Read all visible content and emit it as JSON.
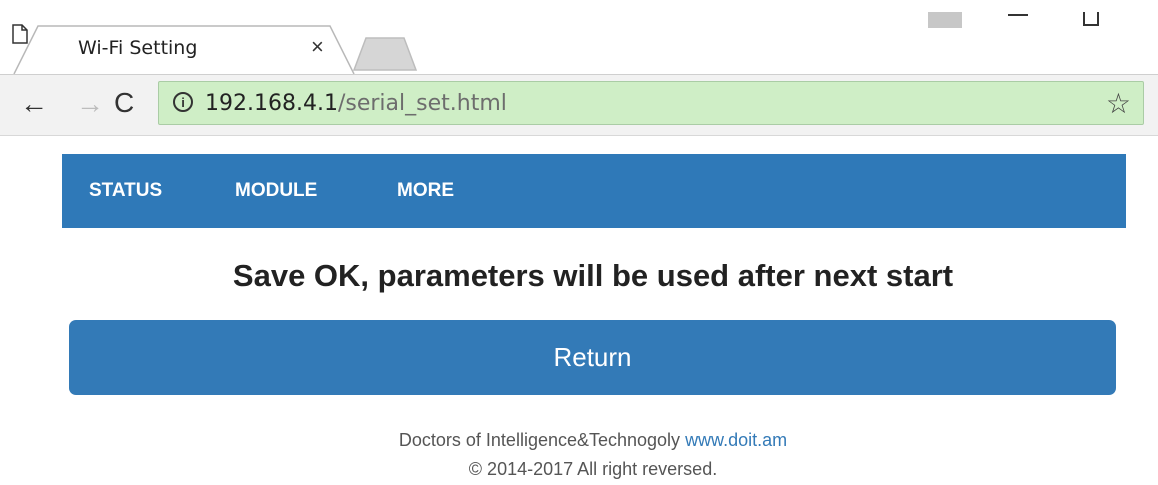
{
  "browser": {
    "tab_title": "Wi-Fi Setting",
    "tab_close": "×",
    "url_host": "192.168.4.1",
    "url_path": "/serial_set.html",
    "nav": {
      "back": "←",
      "forward": "→",
      "reload": "C"
    },
    "star": "☆",
    "info": "i"
  },
  "page": {
    "menu": [
      "STATUS",
      "MODULE",
      "MORE"
    ],
    "message": "Save OK, parameters will be used after next start",
    "return_label": "Return",
    "footer": {
      "line1_text": "Doctors of Intelligence&Technogoly ",
      "line1_link": "www.doit.am",
      "line2": "© 2014-2017 All right reversed."
    }
  },
  "colors": {
    "navbar": "#2f79b8",
    "button": "#337ab7",
    "omnibox": "#cfeec6"
  }
}
